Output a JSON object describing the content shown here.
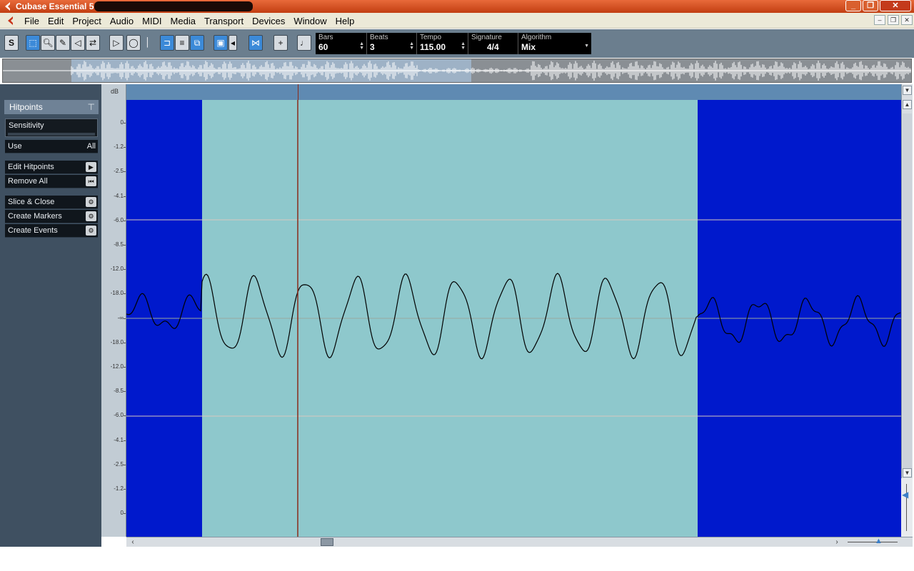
{
  "window": {
    "title": "Cubase Essential 5 -",
    "controls": [
      "minimize",
      "maximize",
      "close"
    ]
  },
  "menu": {
    "items": [
      "File",
      "Edit",
      "Project",
      "Audio",
      "MIDI",
      "Media",
      "Transport",
      "Devices",
      "Window",
      "Help"
    ]
  },
  "toolbar": {
    "fields": {
      "bars": {
        "label": "Bars",
        "value": "60"
      },
      "beats": {
        "label": "Beats",
        "value": "3"
      },
      "tempo": {
        "label": "Tempo",
        "value": "115.00"
      },
      "signature": {
        "label": "Signature",
        "value": "4/4"
      },
      "algorithm": {
        "label": "Algorithm",
        "value": "Mix"
      }
    }
  },
  "hitpoints_panel": {
    "title": "Hitpoints",
    "sensitivity_label": "Sensitivity",
    "use_label": "Use",
    "use_value": "All",
    "edit_hitpoints": "Edit Hitpoints",
    "remove_all": "Remove All",
    "slice_close": "Slice & Close",
    "create_markers": "Create Markers",
    "create_events": "Create Events"
  },
  "db_scale": {
    "title": "dB",
    "ticks": [
      "0",
      "-1.2",
      "-2.5",
      "-4.1",
      "-6.0",
      "-8.5",
      "-12.0",
      "-18.0",
      "-∞",
      "-18.0",
      "-12.0",
      "-8.5",
      "-6.0",
      "-4.1",
      "-2.5",
      "-1.2",
      "0"
    ]
  },
  "colors": {
    "unselected_region": "#0019cc",
    "selected_region": "#8ec8cc",
    "cursor": "#8a2a1a",
    "ruler": "#5f8ab2",
    "panel": "#3f5061"
  }
}
